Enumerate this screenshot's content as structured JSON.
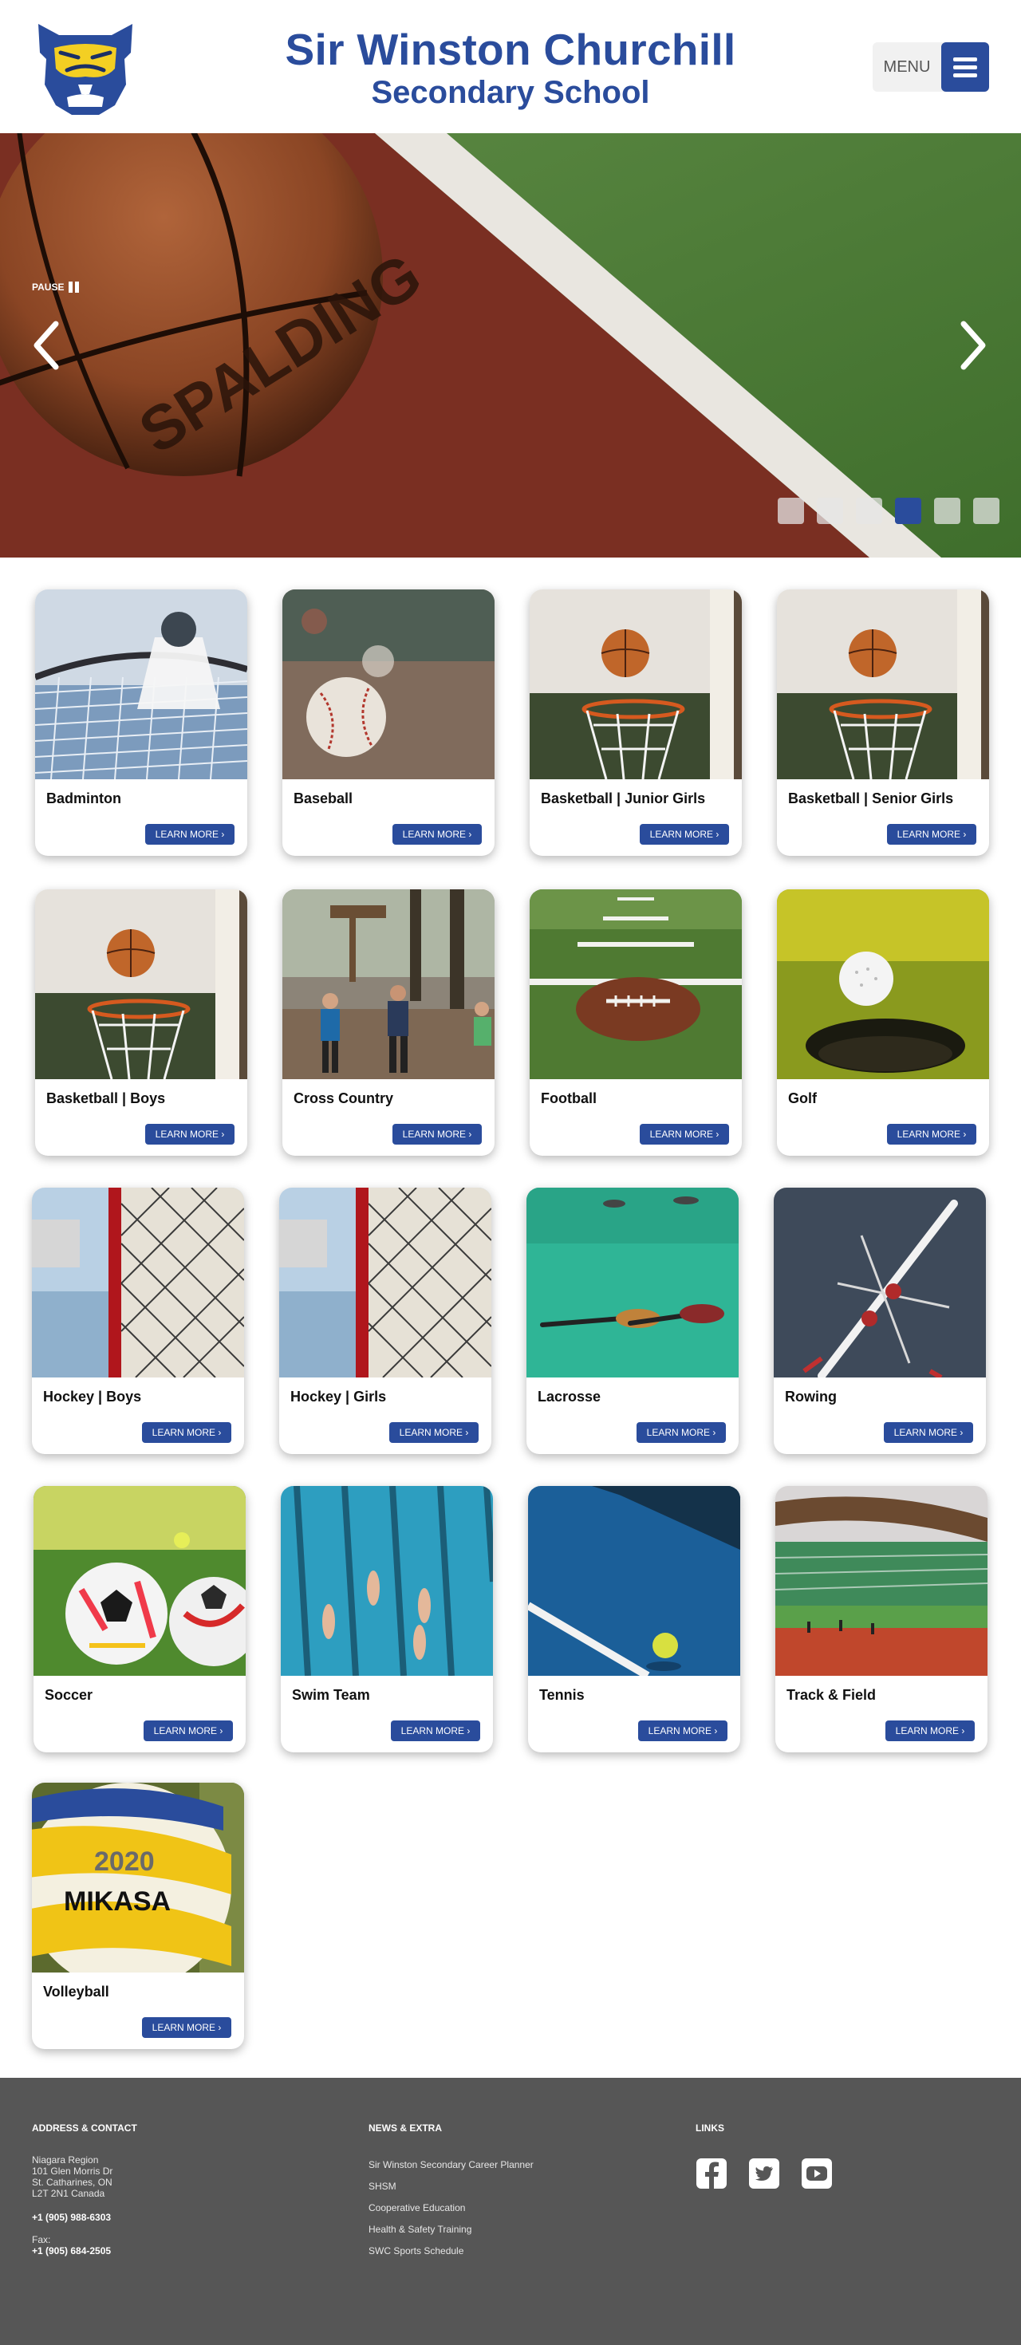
{
  "header": {
    "title_line1": "Sir Winston Churchill",
    "title_line2": "Secondary School",
    "menu_label": "MENU",
    "logo_icon": "bulldog-logo-icon",
    "brand_color": "#2a4c9c"
  },
  "hero": {
    "pause_label": "PAUSE",
    "ball_brand_text": "SPALDING",
    "slide_count": 6,
    "active_slide": 4
  },
  "cards": [
    {
      "name": "Badminton",
      "cta": "LEARN MORE ›"
    },
    {
      "name": "Baseball",
      "cta": "LEARN MORE ›"
    },
    {
      "name": "Basketball | Junior Girls",
      "cta": "LEARN MORE ›"
    },
    {
      "name": "Basketball | Senior Girls",
      "cta": "LEARN MORE ›"
    },
    {
      "name": "Basketball | Boys",
      "cta": "LEARN MORE ›"
    },
    {
      "name": "Cross Country",
      "cta": "LEARN MORE ›"
    },
    {
      "name": "Football",
      "cta": "LEARN MORE ›"
    },
    {
      "name": "Golf",
      "cta": "LEARN MORE ›"
    },
    {
      "name": "Hockey | Boys",
      "cta": "LEARN MORE ›"
    },
    {
      "name": "Hockey | Girls",
      "cta": "LEARN MORE ›"
    },
    {
      "name": "Lacrosse",
      "cta": "LEARN MORE ›"
    },
    {
      "name": "Rowing",
      "cta": "LEARN MORE ›"
    },
    {
      "name": "Soccer",
      "cta": "LEARN MORE ›"
    },
    {
      "name": "Swim Team",
      "cta": "LEARN MORE ›"
    },
    {
      "name": "Tennis",
      "cta": "LEARN MORE ›"
    },
    {
      "name": "Track & Field",
      "cta": "LEARN MORE ›"
    },
    {
      "name": "Volleyball",
      "cta": "LEARN MORE ›"
    }
  ],
  "card_image_text": {
    "volleyball_year": "2020",
    "volleyball_brand": "MIKASA"
  },
  "footer": {
    "address_heading": "ADDRESS & CONTACT",
    "address_lines": [
      "Niagara Region",
      "101 Glen Morris Dr",
      "St. Catharines, ON",
      "L2T 2N1 Canada"
    ],
    "phone": "+1 (905) 988-6303",
    "fax_label": "Fax:",
    "fax": "+1 (905) 684-2505",
    "news_heading": "NEWS & EXTRA",
    "news_links": [
      "Sir Winston Secondary Career Planner",
      "SHSM",
      "Cooperative Education",
      "Health & Safety Training",
      "SWC Sports Schedule"
    ],
    "links_heading": "LINKS",
    "social_icons": [
      "facebook-icon",
      "twitter-icon",
      "youtube-icon"
    ],
    "background": "#565656"
  }
}
